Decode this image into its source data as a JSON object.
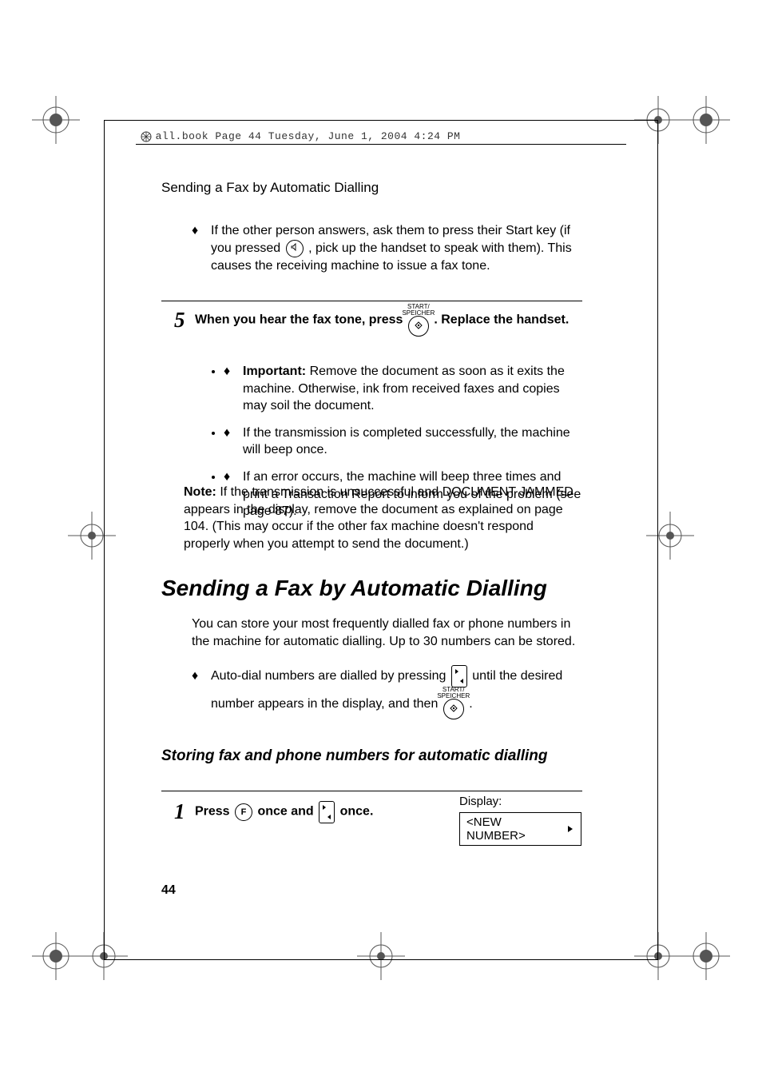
{
  "header": {
    "script_line": "all.book  Page 44  Tuesday, June 1, 2004  4:24 PM"
  },
  "running_head": "Sending a Fax by Automatic Dialling",
  "carryover": {
    "bullet": "If the other person answers, ask them to press their Start key (if you pressed ",
    "bullet_after_icon": ", pick up the handset to speak with them). This causes the receiving machine to issue a fax tone."
  },
  "step5": {
    "num": "5",
    "text_before": "When you hear the fax tone, press ",
    "btn_label": "START/\nSPEICHER",
    "text_after": " . Replace the handset."
  },
  "step5_bullets": {
    "b1_label": "Important:",
    "b1_text": " Remove the document as soon as it exits the machine. Otherwise, ink from received faxes and copies may soil the document.",
    "b2": "If the transmission is completed successfully, the machine will beep once.",
    "b3": "If an error occurs, the machine will beep three times and print a Transaction Report to inform you of the problem (see page 87)."
  },
  "note": {
    "label": "Note:",
    "text": " If the transmission is unsuccessful and DOCUMENT JAMMED appears in the display, remove the document as explained on page 104. (This may occur if the other fax machine doesn't respond properly when you attempt to send the document.)"
  },
  "main_heading": "Sending a Fax by Automatic Dialling",
  "intro": "You can store your most frequently dialled fax or phone numbers in the machine for automatic dialling. Up to 30 numbers can be stored.",
  "auto_dial_bullet": {
    "before": "Auto-dial numbers are dialled by pressing ",
    "mid": " until the desired number appears in the display, and then ",
    "btn_label2": "START/\nSPEICHER",
    "after": "."
  },
  "sub_heading": "Storing fax and phone numbers for automatic dialling",
  "step1": {
    "num": "1",
    "before": "Press ",
    "f_label": "F",
    "mid": " once and ",
    "after": " once."
  },
  "display": {
    "label": "Display:",
    "value": "<NEW NUMBER>"
  },
  "page_number": "44"
}
